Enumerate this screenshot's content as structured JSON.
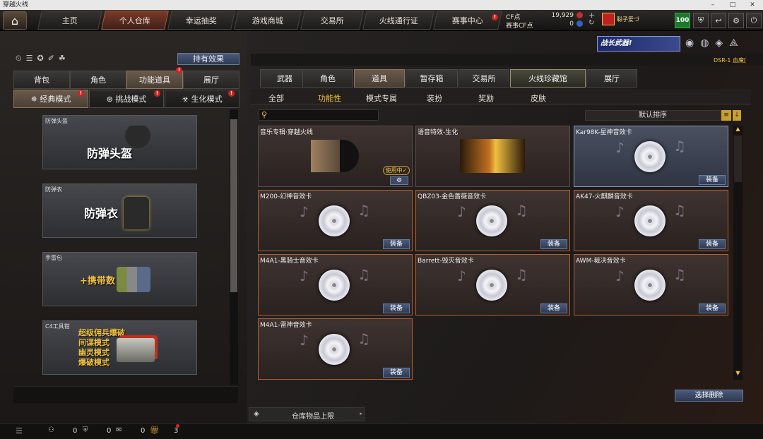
{
  "window": {
    "title": "穿越火线",
    "minimize": "–",
    "maximize": "□",
    "close": "✕"
  },
  "nav": {
    "tabs": [
      "主页",
      "个人仓库",
      "幸运抽奖",
      "游戏商城",
      "交易所",
      "火线通行证",
      "赛事中心"
    ],
    "active": "个人仓库"
  },
  "currency": {
    "cf_label": "CF点",
    "cf_value": "19,929",
    "event_label": "赛事CF点",
    "event_value": "0"
  },
  "user": {
    "name": "聪子爱づ",
    "level": "100"
  },
  "left": {
    "effects_button": "持有效果",
    "categories": [
      "背包",
      "角色",
      "功能道具",
      "展厅"
    ],
    "active_category": "功能道具",
    "modes": [
      "经典模式",
      "挑战模式",
      "生化模式"
    ],
    "cards": [
      {
        "label": "防弹头盔",
        "title": "防弹头盔"
      },
      {
        "label": "防弹衣",
        "title": "防弹衣"
      },
      {
        "label": "手雷包",
        "title": "+携带数"
      },
      {
        "label": "C4工具钳",
        "lines": [
          "超级佣兵爆破",
          "间谍模式",
          "幽灵模式",
          "爆破模式"
        ]
      }
    ]
  },
  "banner": {
    "text": "战长武器!",
    "weapon_tag": "DSR-1 血魔["
  },
  "right": {
    "tabs": [
      "武器",
      "角色",
      "道具",
      "暂存箱",
      "交易所",
      "火线珍藏馆",
      "展厅"
    ],
    "active_tab": "火线珍藏馆",
    "subtabs": [
      "全部",
      "功能性",
      "模式专属",
      "装扮",
      "奖励",
      "皮肤"
    ],
    "active_subtab": "功能性",
    "sort": "默认排序",
    "search_placeholder": "",
    "items": [
      {
        "name": "音乐专辑·穿越火线",
        "status": "使用中✓"
      },
      {
        "name": "语音特效-生化"
      },
      {
        "name": "Kar98K-星神音效卡",
        "button": "装备"
      },
      {
        "name": "M200-幻神音效卡",
        "button": "装备"
      },
      {
        "name": "QBZ03-金色蔷薇音效卡",
        "button": "装备"
      },
      {
        "name": "AK47-火麒麟音效卡",
        "button": "装备"
      },
      {
        "name": "M4A1-黑骑士音效卡",
        "button": "装备"
      },
      {
        "name": "Barrett-毁灭音效卡",
        "button": "装备"
      },
      {
        "name": "AWM-裁决音效卡",
        "button": "装备"
      },
      {
        "name": "M4A1-雷神音效卡",
        "button": "装备"
      }
    ],
    "delete_button": "选择删除",
    "storage_limit": "仓库物品上限"
  },
  "footer": {
    "counts": [
      "0",
      "0",
      "0",
      "0"
    ],
    "notify": "3"
  },
  "icons": {
    "home": "home-icon",
    "search": "search-icon",
    "settings": "gear-icon",
    "power": "power-icon"
  }
}
